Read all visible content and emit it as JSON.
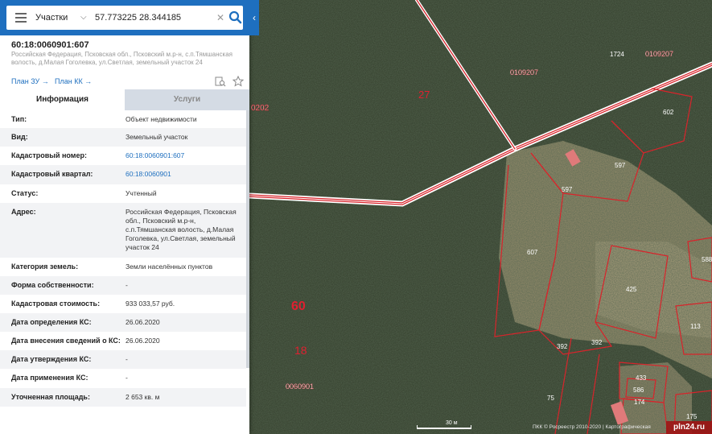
{
  "search": {
    "layer": "Участки",
    "query": "57.773225 28.344185",
    "placeholder": ""
  },
  "object": {
    "title": "60:18:0060901:607",
    "address_short": "Российская Федерация, Псковская обл., Псковский м.р-н, с.п.Тямшанская волость, д.Малая Гоголевка, ул.Светлая, земельный участок 24"
  },
  "links": {
    "plan_zu": "План ЗУ →",
    "plan_kk": "План КК →"
  },
  "tabs": {
    "info": "Информация",
    "services": "Услуги"
  },
  "rows": [
    {
      "label": "Тип:",
      "value": "Объект недвижимости"
    },
    {
      "label": "Вид:",
      "value": "Земельный участок"
    },
    {
      "label": "Кадастровый номер:",
      "value": "60:18:0060901:607"
    },
    {
      "label": "Кадастровый квартал:",
      "value": "60:18:0060901"
    },
    {
      "label": "Статус:",
      "value": "Учтенный"
    },
    {
      "label": "Адрес:",
      "value": "Российская Федерация, Псковская обл., Псковский м.р-н, с.п.Тямшанская волость, д.Малая Гоголевка, ул.Светлая, земельный участок 24"
    },
    {
      "label": "Категория земель:",
      "value": "Земли населённых пунктов"
    },
    {
      "label": "Форма собственности:",
      "value": "-"
    },
    {
      "label": "Кадастровая стоимость:",
      "value": "933 033,57 руб."
    },
    {
      "label": "Дата определения КС:",
      "value": "26.06.2020"
    },
    {
      "label": "Дата внесения сведений о КС:",
      "value": "26.06.2020"
    },
    {
      "label": "Дата утверждения КС:",
      "value": "-"
    },
    {
      "label": "Дата применения КС:",
      "value": "-"
    },
    {
      "label": "Уточненная площадь:",
      "value": "2 653 кв. м"
    }
  ],
  "map": {
    "labels": {
      "q0202": "0202",
      "n27": "27",
      "q0109207a": "0109207",
      "q0109207b": "0109207",
      "n1724": "1724",
      "n602": "602",
      "n597a": "597",
      "n597b": "597",
      "n607": "607",
      "n425": "425",
      "n588": "588",
      "n113": "113",
      "n392a": "392",
      "n392b": "392",
      "n433": "433",
      "n586": "586",
      "n174": "174",
      "n175": "175",
      "n75": "75",
      "n60": "60",
      "n18": "18",
      "q0060901": "0060901"
    },
    "scale": "30 м",
    "copyright": "ПКК © Росреестр 2010-2020 | Картографическая",
    "watermark": "pln24.ru"
  },
  "colors": {
    "accent": "#1e6fbf",
    "boundary": "#d8242b",
    "forest": "#2f3a2a"
  }
}
